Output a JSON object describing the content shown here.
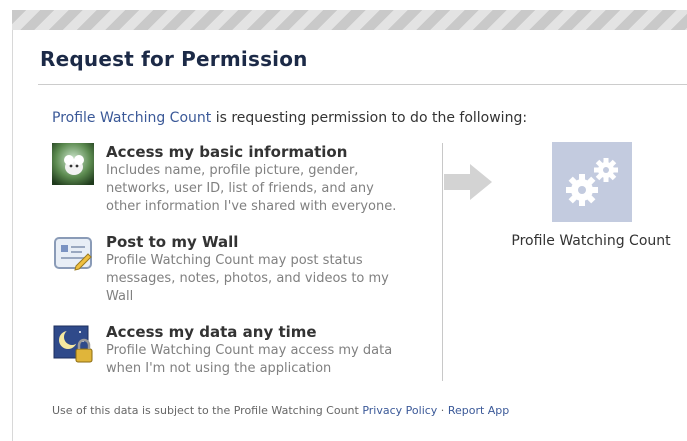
{
  "dialog": {
    "title": "Request for Permission",
    "intro": {
      "app_name": "Profile Watching Count",
      "text": " is requesting permission to do the following:"
    },
    "permissions": [
      {
        "icon": "basic-info-avatar-icon",
        "title": "Access my basic information",
        "description": "Includes name, profile picture, gender, networks, user ID, list of friends, and any other information I've shared with everyone."
      },
      {
        "icon": "wall-post-icon",
        "title": "Post to my Wall",
        "description": "Profile Watching Count may post status messages, notes, photos, and videos to my Wall"
      },
      {
        "icon": "offline-access-lock-icon",
        "title": "Access my data any time",
        "description": "Profile Watching Count may access my data when I'm not using the application"
      }
    ],
    "app_tile": {
      "icon": "gears-icon",
      "name": "Profile Watching Count",
      "tile_color": "#c3cbdf"
    },
    "footer": {
      "prefix": "Use of this data is subject to the Profile Watching Count ",
      "privacy_policy": "Privacy Policy",
      "separator": " · ",
      "report_app": "Report App"
    }
  },
  "colors": {
    "title": "#1c2a47",
    "link": "#3b5998",
    "muted_text": "#808080"
  }
}
